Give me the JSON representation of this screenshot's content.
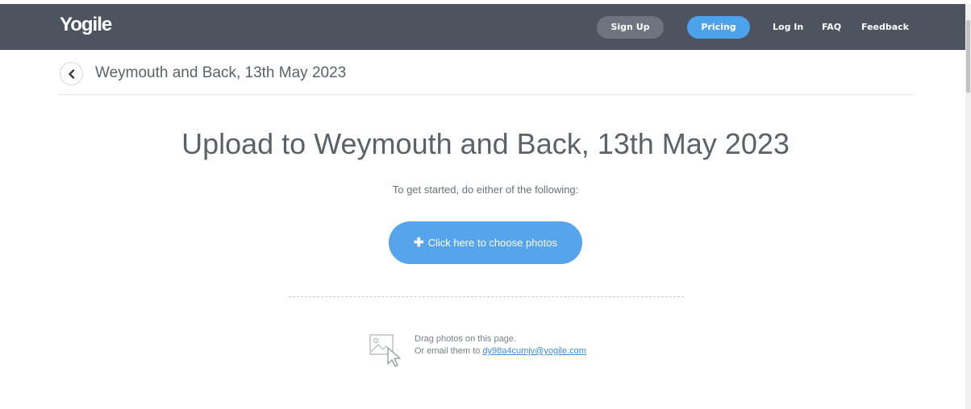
{
  "navbar": {
    "logo": "Yogile",
    "signup_label": "Sign Up",
    "pricing_label": "Pricing",
    "login_label": "Log In",
    "faq_label": "FAQ",
    "feedback_label": "Feedback"
  },
  "breadcrumb": {
    "title": "Weymouth and Back, 13th May 2023"
  },
  "main": {
    "title": "Upload to Weymouth and Back, 13th May 2023",
    "subtitle": "To get started, do either of the following:",
    "choose_button": "Click here to choose photos",
    "drag_text": "Drag photos on this page.",
    "email_prefix": "Or email them to ",
    "email_address": "dy98a4cumjv@yogile.com"
  },
  "colors": {
    "navbar": "#4d5460",
    "accent": "#55a4ec",
    "signup_button": "#6f7580"
  },
  "icons": {
    "back": "chevron-left-icon",
    "plus": "plus-icon",
    "drag": "image-drag-icon"
  }
}
